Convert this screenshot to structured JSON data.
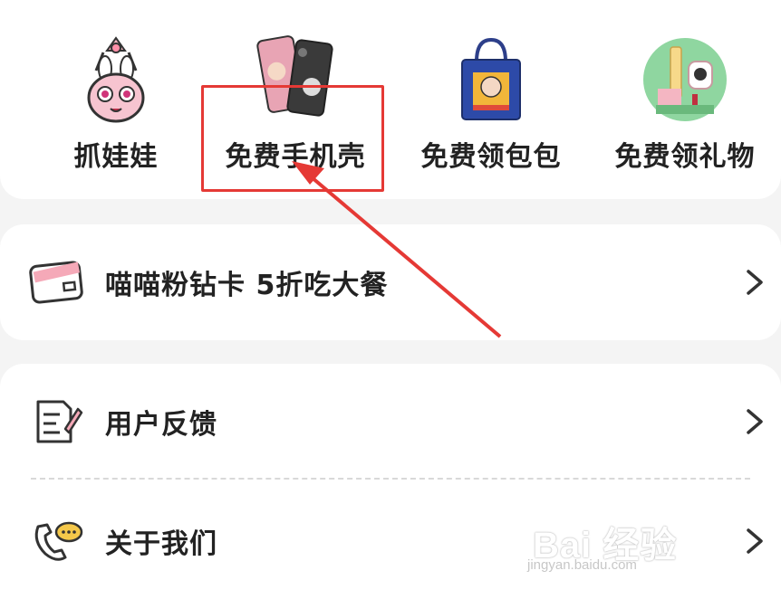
{
  "features": [
    {
      "label": "抓娃娃",
      "icon": "claw-bunny-icon"
    },
    {
      "label": "免费手机壳",
      "icon": "phone-case-icon"
    },
    {
      "label": "免费领包包",
      "icon": "tote-bag-icon"
    },
    {
      "label": "免费领礼物",
      "icon": "gift-products-icon"
    }
  ],
  "vip": {
    "label": "喵喵粉钻卡 5折吃大餐",
    "icon": "pink-card-icon"
  },
  "menu": [
    {
      "label": "用户反馈",
      "icon": "feedback-note-icon"
    },
    {
      "label": "关于我们",
      "icon": "phone-chat-icon"
    }
  ],
  "watermark": {
    "brand": "Bai 经验",
    "url": "jingyan.baidu.com"
  },
  "colors": {
    "highlight": "#e53935",
    "background": "#f4f4f4",
    "card": "#ffffff"
  }
}
